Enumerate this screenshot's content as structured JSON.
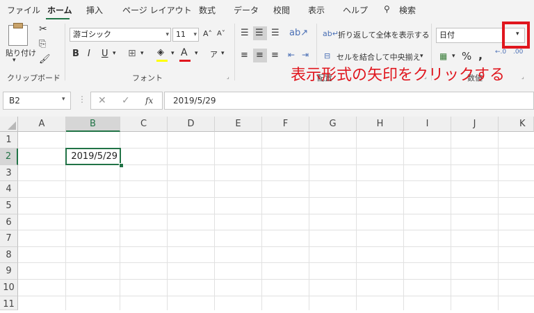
{
  "tabs": [
    "ファイル",
    "ホーム",
    "挿入",
    "ページ レイアウト",
    "数式",
    "データ",
    "校閲",
    "表示",
    "ヘルプ",
    "検索"
  ],
  "active_tab": "ホーム",
  "clipboard": {
    "paste_label": "貼り付け",
    "group_label": "クリップボード"
  },
  "font": {
    "name": "游ゴシック",
    "size": "11",
    "group_label": "フォント"
  },
  "alignment": {
    "wrap_text": "折り返して全体を表示する",
    "merge_center": "セルを結合して中央揃え",
    "group_label": "配置"
  },
  "number": {
    "format": "日付",
    "group_label": "数値"
  },
  "formula_bar": {
    "name_box": "B2",
    "fx": "fx",
    "value": "2019/5/29"
  },
  "grid": {
    "columns": [
      "A",
      "B",
      "C",
      "D",
      "E",
      "F",
      "G",
      "H",
      "I",
      "J",
      "K"
    ],
    "rows": [
      "1",
      "2",
      "3",
      "4",
      "5",
      "6",
      "7",
      "8",
      "9",
      "10",
      "11"
    ],
    "selected_cell_value": "2019/5/29"
  },
  "annotation": {
    "text": "表示形式の矢印をクリックする",
    "color": "#e0161e"
  },
  "colors": {
    "accent": "#217346",
    "highlight_box": "#e0161e"
  }
}
